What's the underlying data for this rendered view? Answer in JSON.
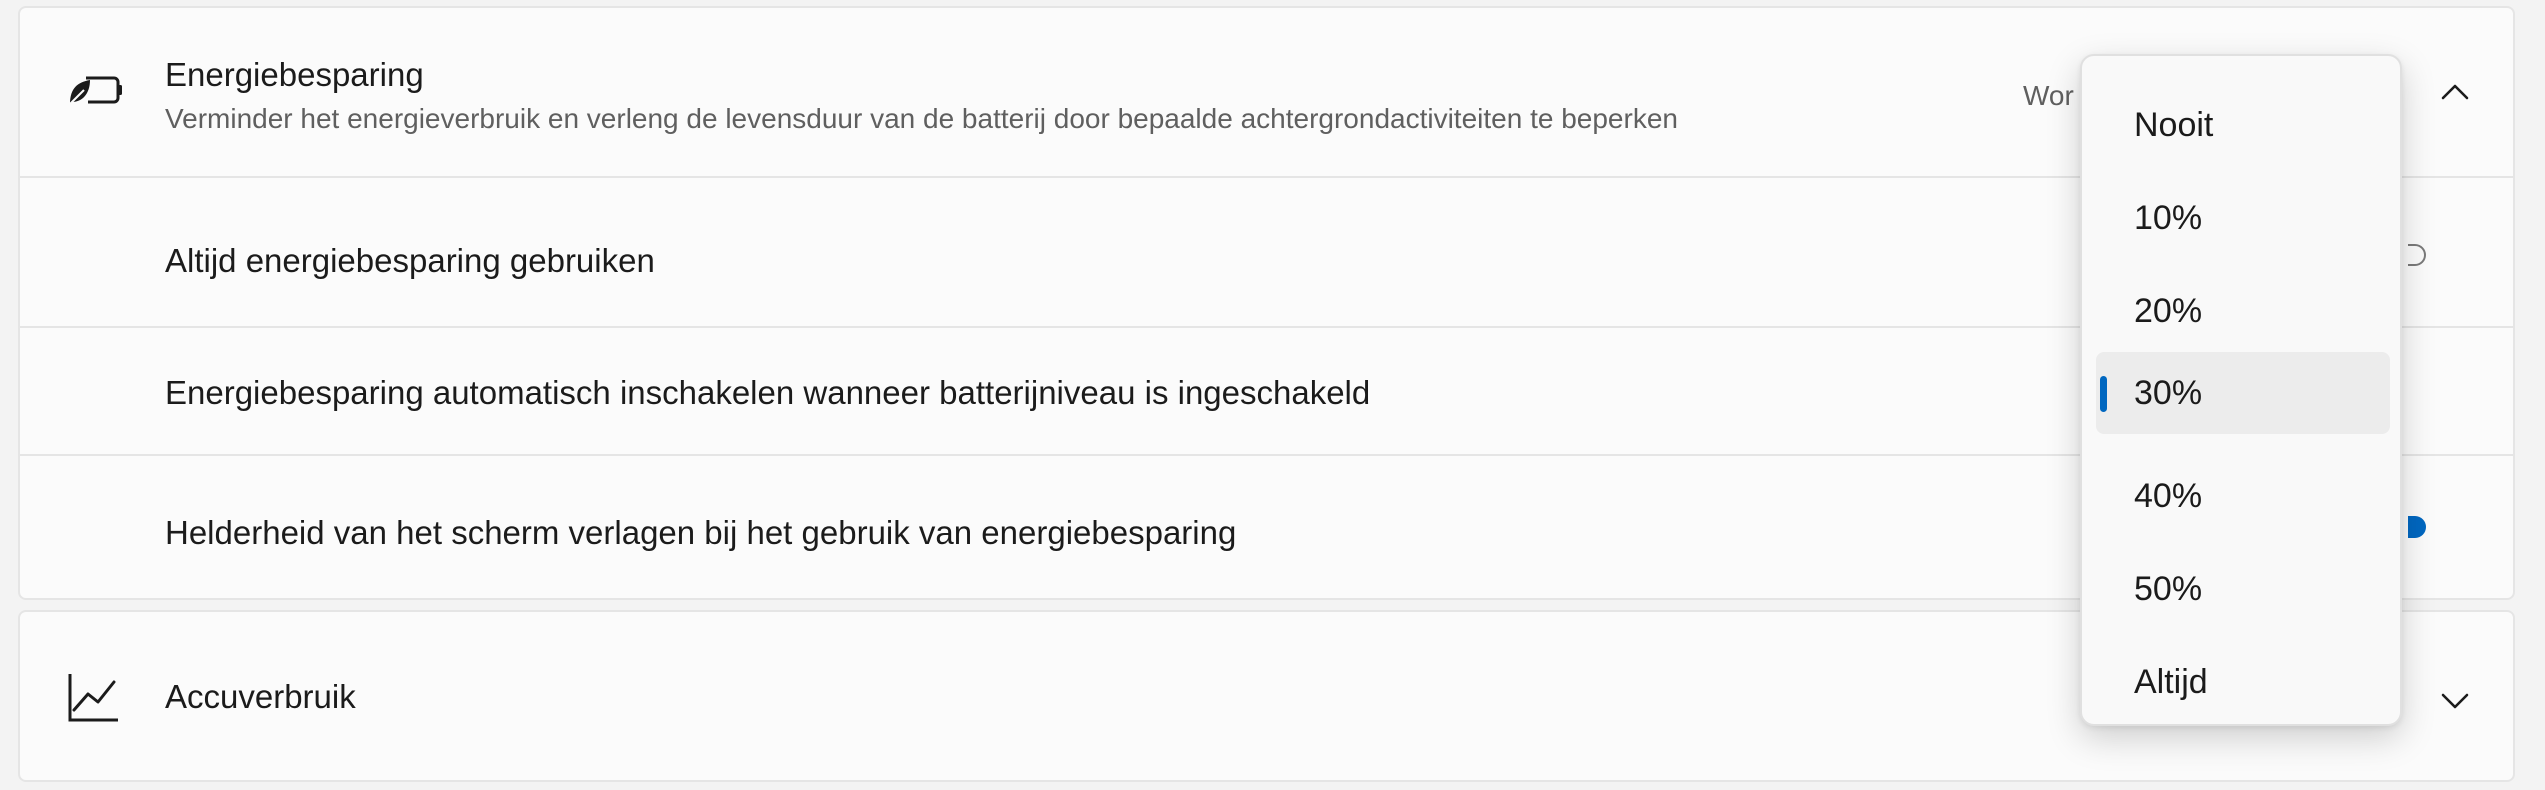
{
  "energy_saver": {
    "title": "Energiebesparing",
    "description": "Verminder het energieverbruik en verleng de levensduur van de batterij door bepaalde achtergrondactiviteiten te beperken",
    "value_text": "Wor",
    "icon": "battery-leaf-icon",
    "expanded_icon": "chevron-up-icon",
    "settings": [
      {
        "label": "Altijd energiebesparing gebruiken",
        "control": "toggle",
        "state": "off"
      },
      {
        "label": "Energiebesparing automatisch inschakelen wanneer batterijniveau is ingeschakeld",
        "control": "dropdown"
      },
      {
        "label": "Helderheid van het scherm verlagen bij het gebruik van energiebesparing",
        "control": "toggle",
        "state": "on"
      }
    ]
  },
  "battery_usage": {
    "title": "Accuverbruik",
    "icon": "line-chart-icon",
    "expand_icon": "chevron-down-icon"
  },
  "threshold_dropdown": {
    "options": [
      "Nooit",
      "10%",
      "20%",
      "30%",
      "40%",
      "50%",
      "Altijd"
    ],
    "selected": "30%"
  },
  "colors": {
    "accent": "#0067c0",
    "card_background": "#fbfbfb",
    "page_background": "#f3f3f3",
    "divider": "#e5e5e5",
    "secondary_text": "#5f5f5f"
  }
}
